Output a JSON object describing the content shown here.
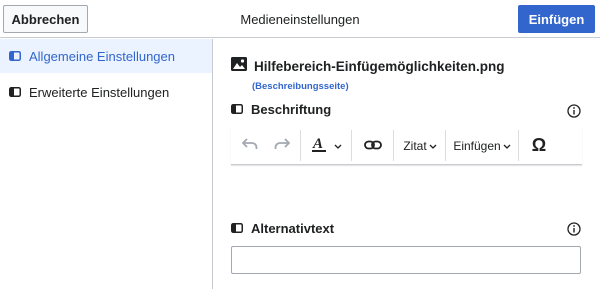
{
  "dialog": {
    "title": "Medieneinstellungen",
    "cancel_label": "Abbrechen",
    "insert_label": "Einfügen"
  },
  "sidebar": {
    "items": [
      {
        "label": "Allgemeine Einstellungen",
        "active": true
      },
      {
        "label": "Erweiterte Einstellungen",
        "active": false
      }
    ]
  },
  "main": {
    "file_name": "Hilfebereich-Einfügemöglichkeiten.png",
    "description_link": "(Beschreibungsseite)",
    "caption_label": "Beschriftung",
    "alt_label": "Alternativtext",
    "alt_value": "",
    "toolbar": {
      "cite_label": "Zitat",
      "insert_label": "Einfügen",
      "special_char": "Ω"
    }
  },
  "colors": {
    "accent": "#3366cc",
    "active_bg": "#eaf3ff",
    "border": "#c8ccd1"
  }
}
